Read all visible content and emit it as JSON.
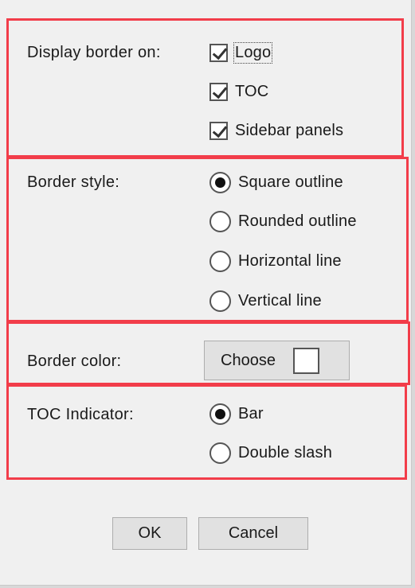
{
  "display_border": {
    "label": "Display border on:",
    "options": [
      {
        "label": "Logo",
        "checked": true
      },
      {
        "label": "TOC",
        "checked": true
      },
      {
        "label": "Sidebar panels",
        "checked": true
      }
    ]
  },
  "border_style": {
    "label": "Border style:",
    "options": [
      {
        "label": "Square outline",
        "selected": true
      },
      {
        "label": "Rounded outline",
        "selected": false
      },
      {
        "label": "Horizontal line",
        "selected": false
      },
      {
        "label": "Vertical line",
        "selected": false
      }
    ]
  },
  "border_color": {
    "label": "Border color:",
    "button_label": "Choose",
    "color": "#ffffff"
  },
  "toc_indicator": {
    "label": "TOC Indicator:",
    "options": [
      {
        "label": "Bar",
        "selected": true
      },
      {
        "label": "Double slash",
        "selected": false
      }
    ]
  },
  "buttons": {
    "ok": "OK",
    "cancel": "Cancel"
  },
  "highlight_color": "#f23d4a"
}
